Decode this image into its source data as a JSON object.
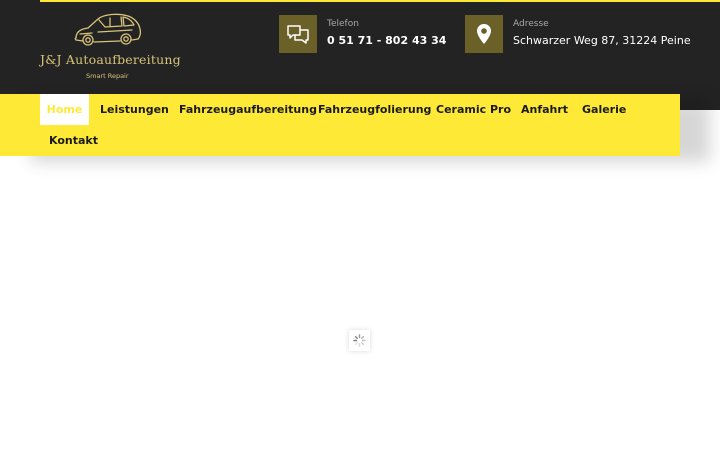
{
  "brand": {
    "name": "J&J Autoaufbereitung",
    "tagline": "Smart Repair"
  },
  "contact": {
    "phone": {
      "label": "Telefon",
      "value": "0 51 71 - 802 43 34",
      "icon": "chat-icon"
    },
    "address": {
      "label": "Adresse",
      "value": "Schwarzer Weg 87, 31224 Peine",
      "icon": "map-pin-icon"
    }
  },
  "nav": {
    "items": [
      {
        "label": "Home",
        "active": true
      },
      {
        "label": "Leistungen"
      },
      {
        "label": "Fahrzeugaufbereitung"
      },
      {
        "label": "Fahrzeugfolierung"
      },
      {
        "label": "Ceramic Pro"
      },
      {
        "label": "Anfahrt"
      },
      {
        "label": "Galerie"
      },
      {
        "label": "Kontakt"
      }
    ]
  },
  "loader": {
    "icon": "loading-spinner-icon"
  },
  "colors": {
    "accent": "#ffe937",
    "header_bg": "#232323",
    "icon_box": "#6b6028",
    "logo_gold": "#d8c37a"
  }
}
